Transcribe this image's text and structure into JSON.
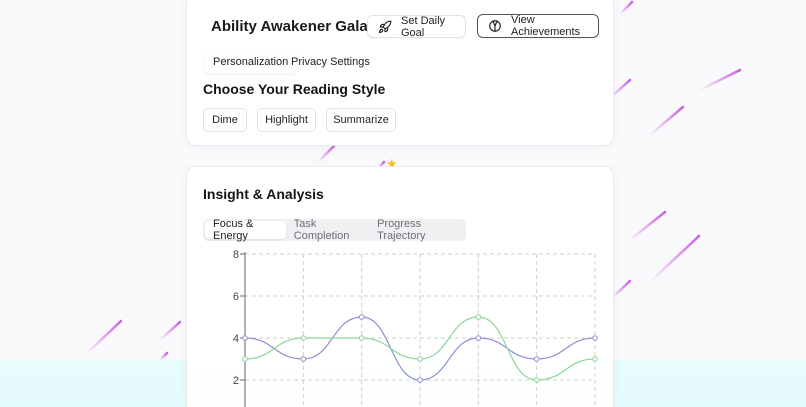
{
  "app": {
    "title": "Ability Awakener Galaxy",
    "set_goal_label": "Set Daily Goal",
    "achievements_label": "View Achievements",
    "set_goal_icon": "rocket-icon",
    "achievements_icon": "medal-icon"
  },
  "settings_tabs": [
    {
      "label": "Personalization",
      "active": true
    },
    {
      "label": "Privacy Settings",
      "active": false
    }
  ],
  "reading_style": {
    "title": "Choose Your Reading Style",
    "options": [
      "Dime",
      "Highlight",
      "Summarize"
    ]
  },
  "insight": {
    "title": "Insight & Analysis",
    "tabs": [
      {
        "label": "Focus & Energy",
        "active": true
      },
      {
        "label": "Task Completion",
        "active": false
      },
      {
        "label": "Progress Trajectory",
        "active": false
      }
    ]
  },
  "decor": {
    "star": "★",
    "star_color": "#f0c419"
  },
  "colors": {
    "series_purple": "#8f8fd6",
    "series_green": "#8fd49a",
    "grid": "#cfcfcf",
    "streak": "#c040e0"
  },
  "chart_data": {
    "type": "line",
    "x": [
      0,
      1,
      2,
      3,
      4,
      5,
      6
    ],
    "series": [
      {
        "values": [
          4,
          3,
          5,
          2,
          4,
          3,
          4
        ],
        "color": "#8f8fd6"
      },
      {
        "values": [
          3,
          4,
          4,
          3,
          5,
          2,
          3
        ],
        "color": "#8fd49a"
      }
    ],
    "ylim": [
      0,
      8
    ],
    "yticks": [
      "2",
      "4",
      "6",
      "8"
    ],
    "grid": true
  }
}
